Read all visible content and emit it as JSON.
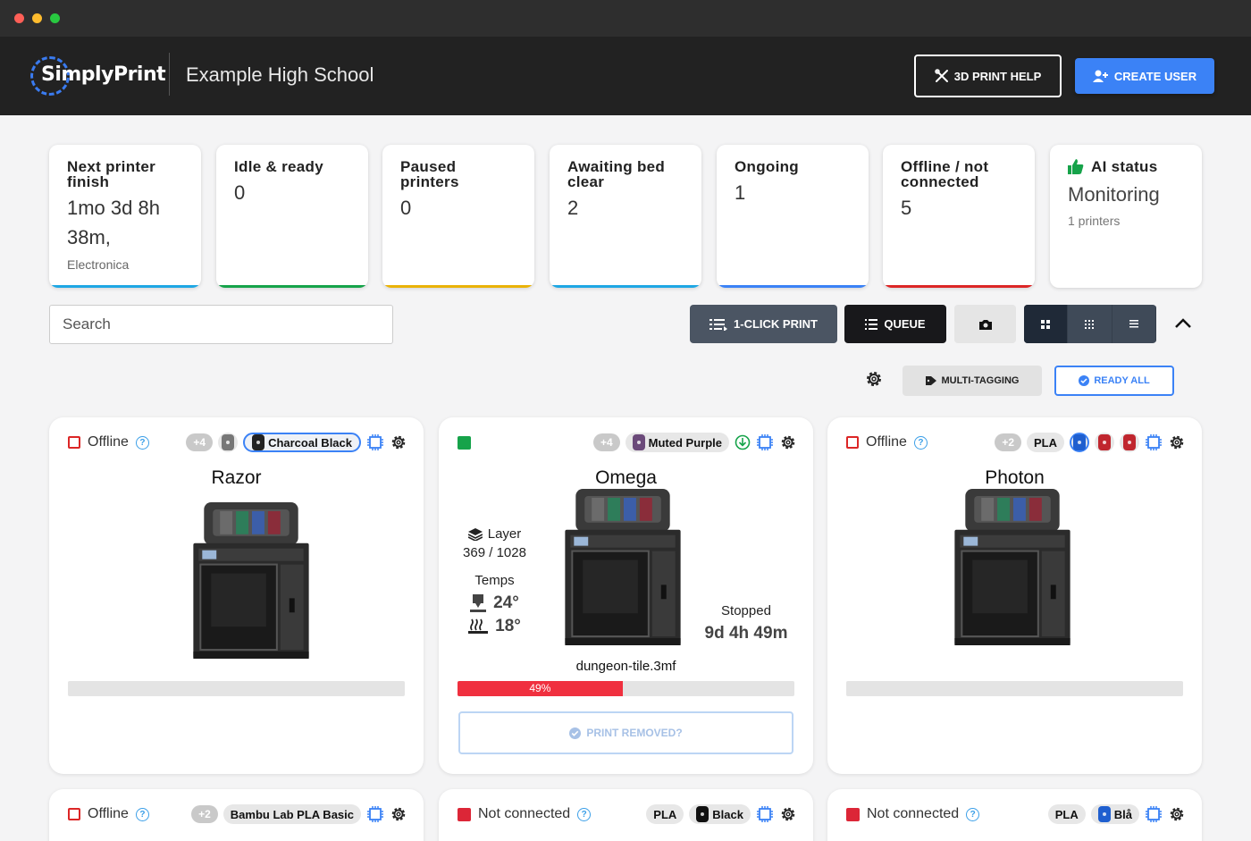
{
  "header": {
    "logo": "SimplyPrint",
    "school": "Example High School",
    "help_label": "3D PRINT HELP",
    "create_label": "CREATE USER"
  },
  "stats": {
    "next_finish": {
      "title": "Next printer finish",
      "value": "1mo 3d 8h 38m,",
      "sub": "Electronica",
      "color": "#1ea7e4"
    },
    "idle": {
      "title": "Idle & ready",
      "value": "0",
      "color": "#16a34a"
    },
    "paused": {
      "title": "Paused printers",
      "value": "0",
      "color": "#eab308"
    },
    "awaiting": {
      "title": "Awaiting bed clear",
      "value": "2",
      "color": "#1ea7e4"
    },
    "ongoing": {
      "title": "Ongoing",
      "value": "1",
      "color": "#3b82f6"
    },
    "offline": {
      "title": "Offline / not connected",
      "value": "5",
      "color": "#dc2626"
    },
    "ai": {
      "title": "AI status",
      "value": "Monitoring",
      "sub": "1 printers"
    }
  },
  "toolbar": {
    "search_placeholder": "Search",
    "oneclick_label": "1-CLICK PRINT",
    "queue_label": "QUEUE",
    "multitag_label": "MULTI-TAGGING",
    "readyall_label": "READY ALL"
  },
  "printers": [
    {
      "name": "Razor",
      "status": "Offline",
      "more": "+4",
      "filament": "Charcoal Black"
    },
    {
      "name": "Omega",
      "more": "+4",
      "filament": "Muted Purple",
      "layer_label": "Layer",
      "layer": "369 / 1028",
      "temps_label": "Temps",
      "nozzle": "24°",
      "bed": "18°",
      "state": "Stopped",
      "remaining": "9d 4h 49m",
      "file": "dungeon-tile.3mf",
      "progress": 49,
      "progress_label": "49%",
      "removed_label": "PRINT REMOVED?"
    },
    {
      "name": "Photon",
      "status": "Offline",
      "more": "+2",
      "filament": "PLA"
    },
    {
      "status": "Offline",
      "more": "+2",
      "filament": "Bambu Lab PLA Basic"
    },
    {
      "status": "Not connected",
      "material": "PLA",
      "filament": "Black"
    },
    {
      "status": "Not connected",
      "material": "PLA",
      "filament": "Blå"
    }
  ]
}
